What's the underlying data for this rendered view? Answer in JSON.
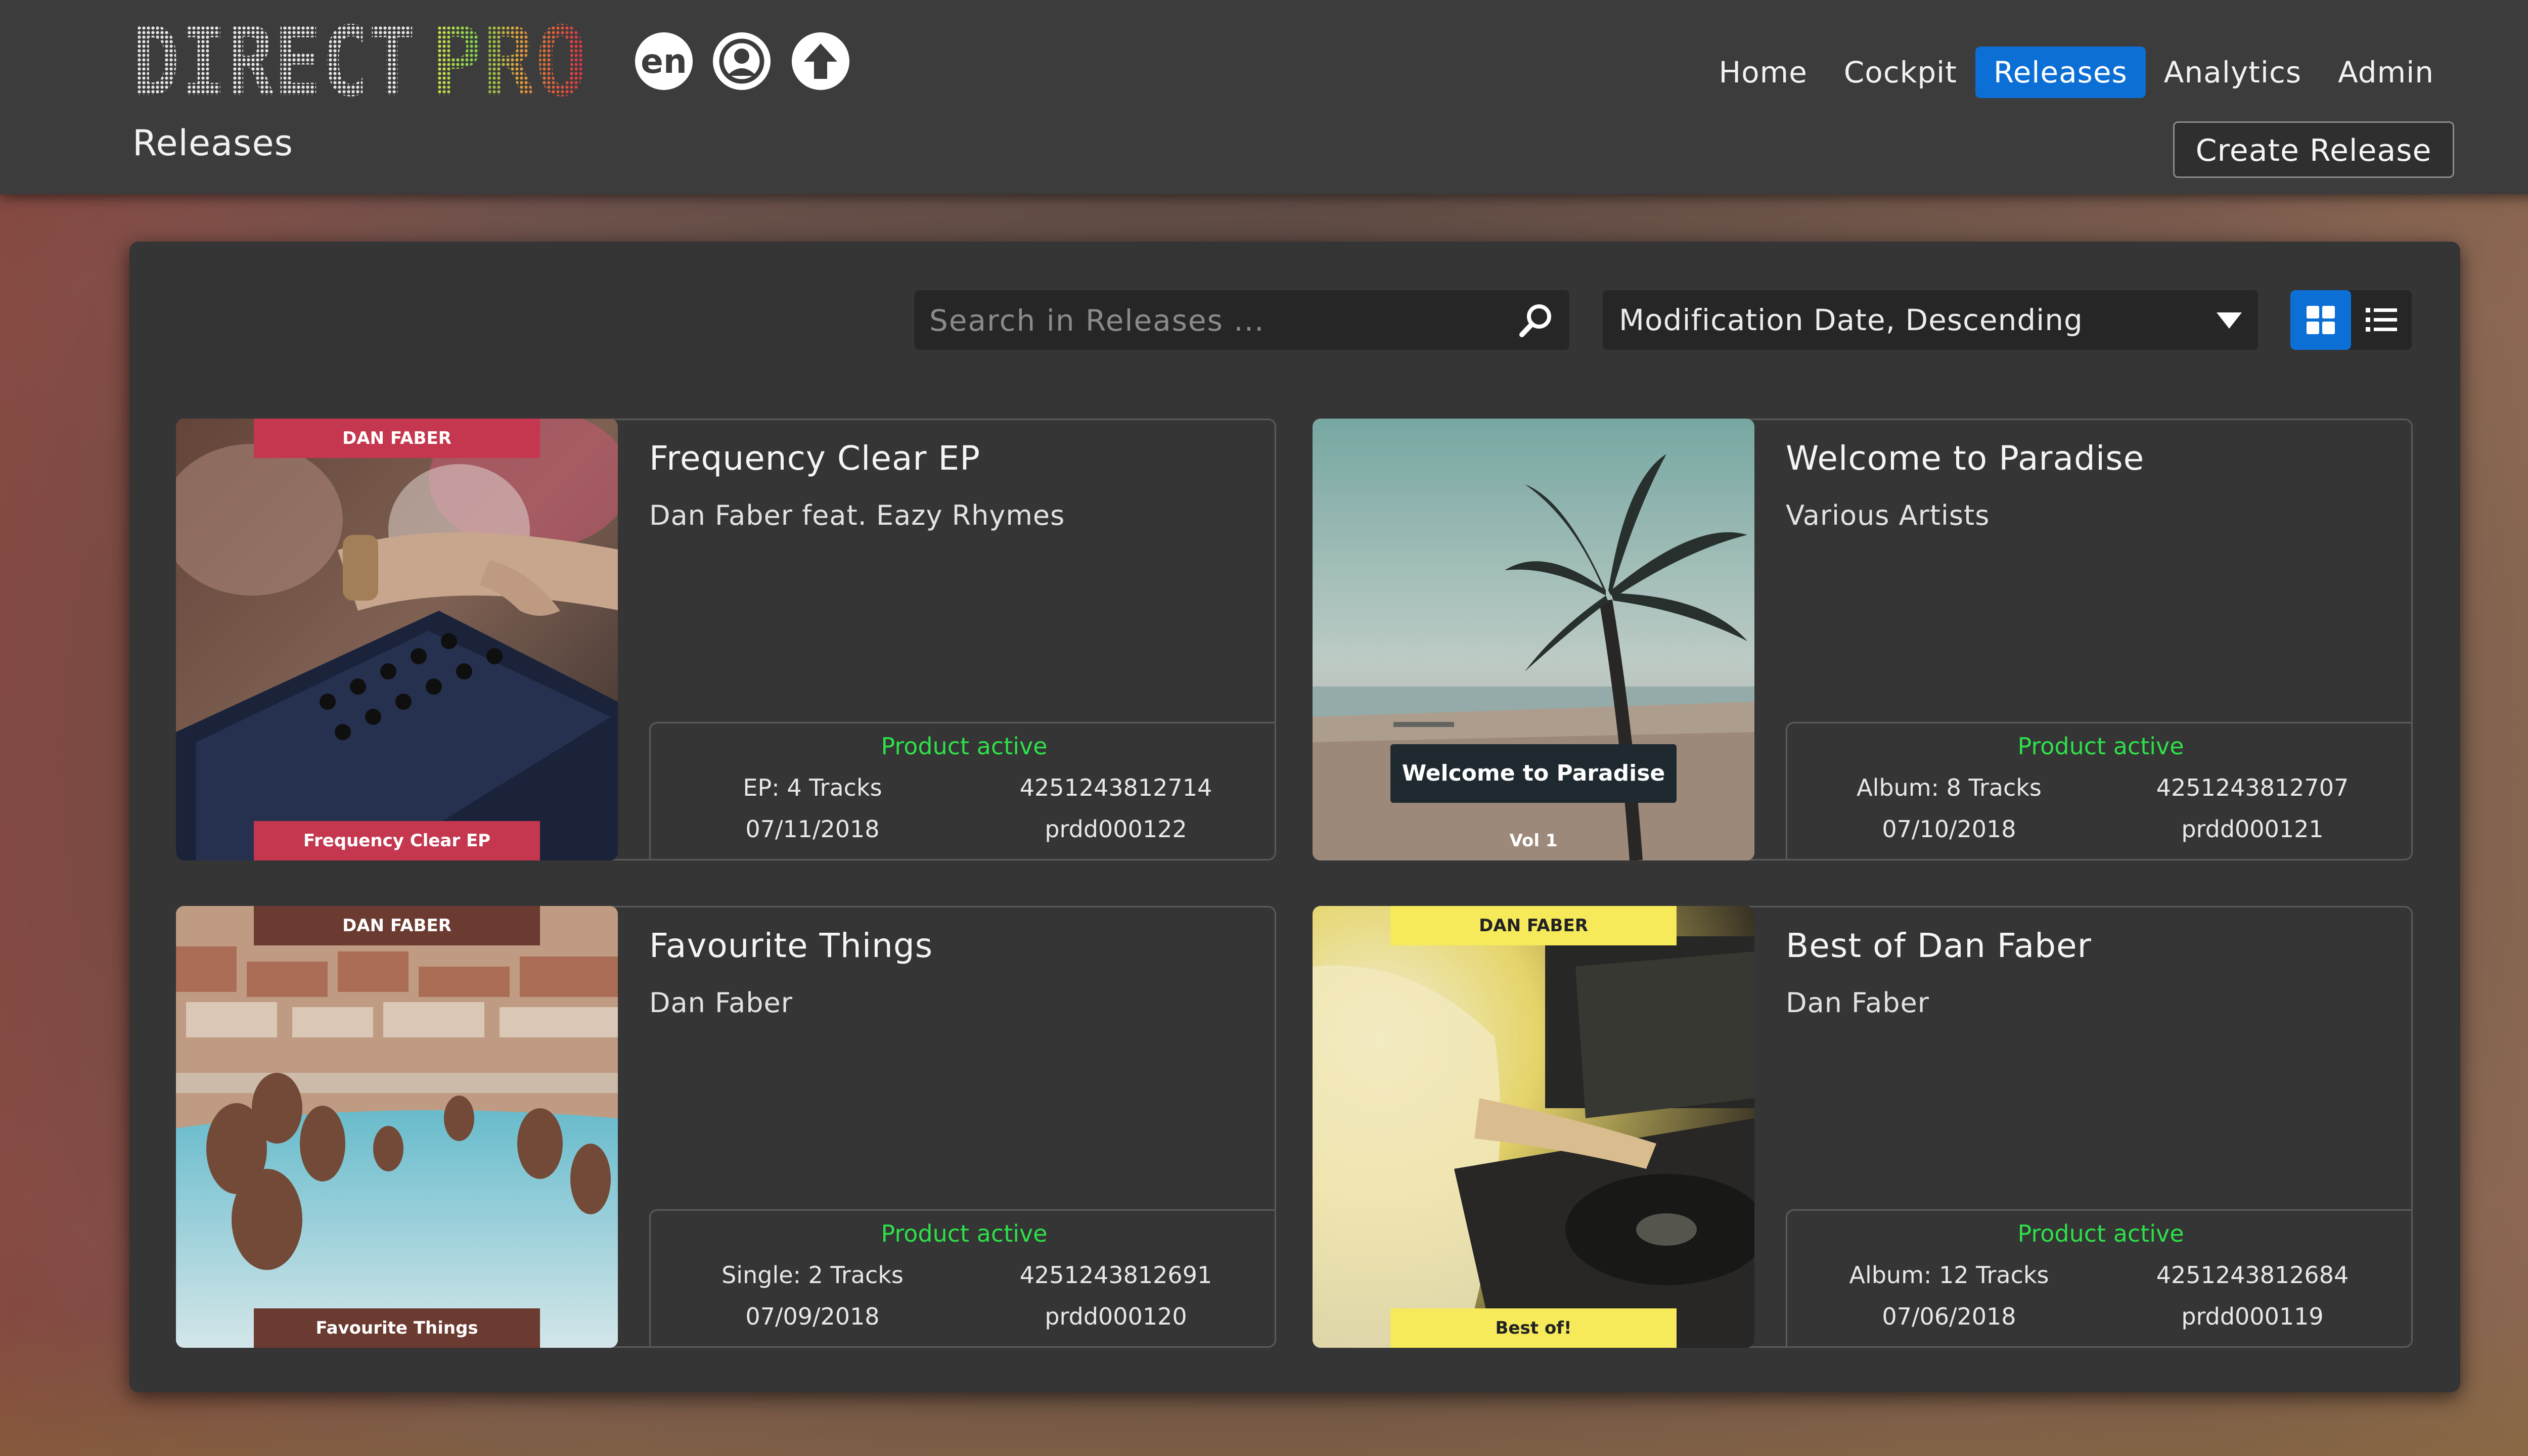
{
  "header": {
    "logo": {
      "text_a": "DIRECT",
      "text_b": "PRO"
    },
    "language": "en",
    "nav": [
      {
        "label": "Home",
        "active": false
      },
      {
        "label": "Cockpit",
        "active": false
      },
      {
        "label": "Releases",
        "active": true
      },
      {
        "label": "Analytics",
        "active": false
      },
      {
        "label": "Admin",
        "active": false
      }
    ],
    "page_title": "Releases",
    "create_button": "Create Release"
  },
  "toolbar": {
    "search_placeholder": "Search in Releases ...",
    "search_value": "",
    "sort_selected": "Modification Date, Descending",
    "view_mode": "grid"
  },
  "releases": [
    {
      "title": "Frequency Clear EP",
      "artist": "Dan Faber feat. Eazy Rhymes",
      "status": "Product active",
      "format": "EP: 4 Tracks",
      "ean": "4251243812714",
      "date": "07/11/2018",
      "id": "prdd000122",
      "cover_top": "DAN FABER",
      "cover_bottom": "Frequency Clear EP"
    },
    {
      "title": "Welcome to Paradise",
      "artist": "Various Artists",
      "status": "Product active",
      "format": "Album: 8 Tracks",
      "ean": "4251243812707",
      "date": "07/10/2018",
      "id": "prdd000121",
      "cover_top": "Welcome to Paradise",
      "cover_bottom": "Vol 1"
    },
    {
      "title": "Favourite Things",
      "artist": "Dan Faber",
      "status": "Product active",
      "format": "Single: 2 Tracks",
      "ean": "4251243812691",
      "date": "07/09/2018",
      "id": "prdd000120",
      "cover_top": "DAN FABER",
      "cover_bottom": "Favourite Things"
    },
    {
      "title": "Best of Dan Faber",
      "artist": "Dan Faber",
      "status": "Product active",
      "format": "Album: 12 Tracks",
      "ean": "4251243812684",
      "date": "07/06/2018",
      "id": "prdd000119",
      "cover_top": "DAN FABER",
      "cover_bottom": "Best of!"
    }
  ],
  "colors": {
    "accent": "#0c6fd6",
    "status_active": "#2ee04a",
    "tag_red": "#c4374f",
    "tag_brown": "#6b3a30",
    "tag_yellow": "#f6ea5a"
  }
}
